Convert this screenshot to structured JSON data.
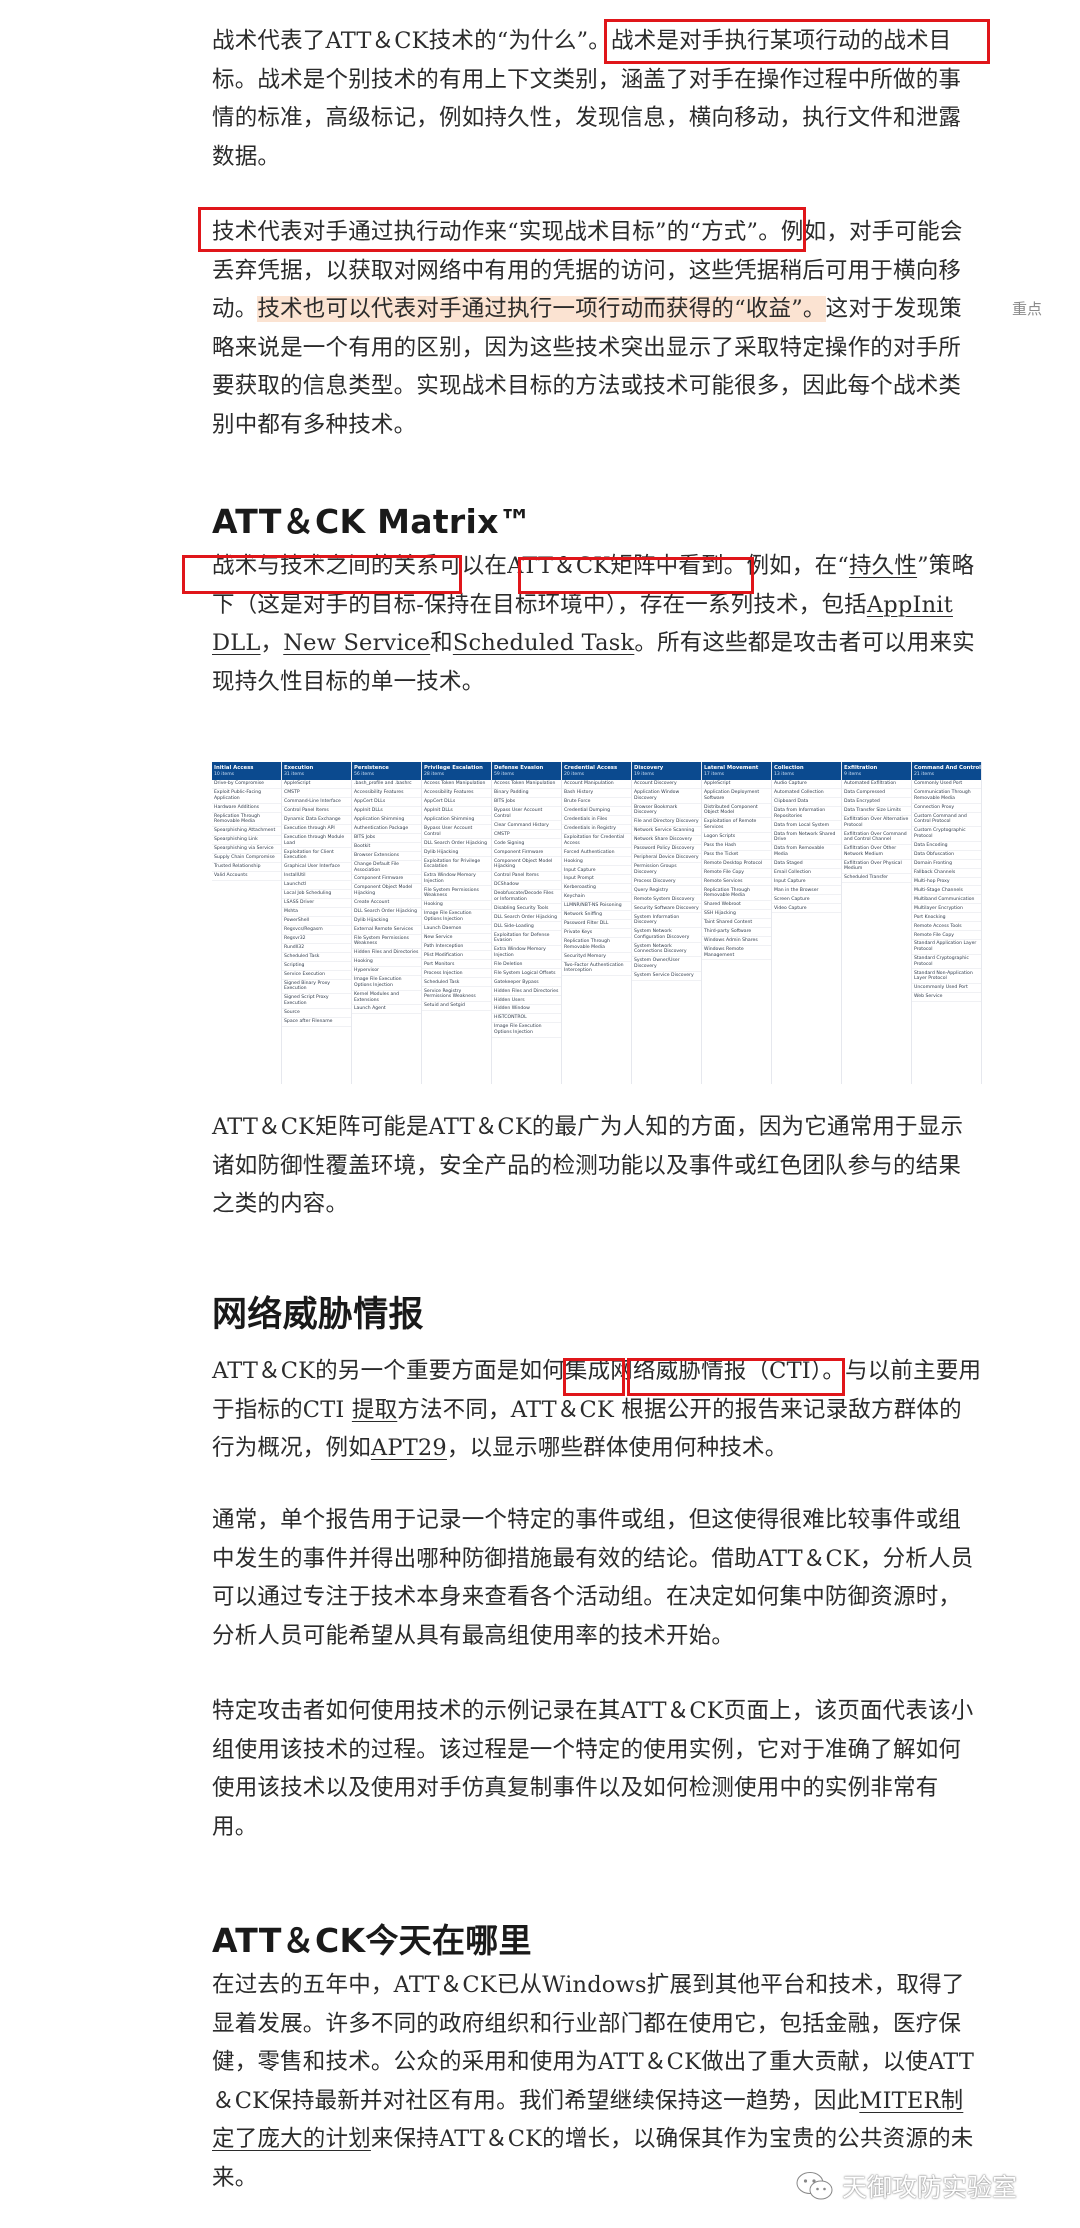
{
  "sections": {
    "intro": {
      "p1": [
        {
          "t": "战术代表了ATT＆CK技术的“为什么”。"
        },
        {
          "t": "战术是对手执行某项行动的战术目标。战术是个别技术的有用上下文类别，涵盖了对手在操作过程中所做的事情的标准，高级标记，例如持久性，发现信息，横向移动，执行文件和泄露数据。"
        }
      ],
      "p2": [
        {
          "t": "技术代表对手通过执行动作来“实现战术目标”的“方式”。"
        },
        {
          "t": "例如，对手可能会丢弃凭据，以获取对网络中有用的凭据的访问，这些凭据稍后可用于横向移动。"
        },
        {
          "t": "技术也可以代表对手通过执行一项行动而获得的“收益”。",
          "hl": true
        },
        {
          "t": "这对于发现策略来说是一个有用的区别，因为这些技术突出显示了采取特定操作的对手所要获取的信息类型。实现战术目标的方法或技术可能很多，因此每个战术类别中都有多种技术。"
        }
      ],
      "side_note": "重点"
    },
    "matrix": {
      "heading": "ATT＆CK Matrix™",
      "p1": [
        {
          "t": "战术与技术之间的关系可以在ATT＆CK矩阵中看到。例如，在“"
        },
        {
          "t": "持久性",
          "u": true
        },
        {
          "t": "”策略下（这是对手的目标-保持在目标环境中），存在一系列技术，包括"
        },
        {
          "t": "AppInit DLL",
          "u": true
        },
        {
          "t": "，"
        },
        {
          "t": "New Service",
          "u": true
        },
        {
          "t": "和"
        },
        {
          "t": "Scheduled Task",
          "u": true
        },
        {
          "t": "。所有这些都是攻击者可以用来实现持久性目标的单一技术。"
        }
      ],
      "p2": [
        {
          "t": "ATT＆CK矩阵可能是ATT＆CK的最广为人知的方面，因为它通常用于显示诸如防御性覆盖环境，安全产品的检测功能以及事件或红色团队参与的结果之类的内容。"
        }
      ]
    },
    "cti": {
      "heading": "网络威胁情报",
      "p1": [
        {
          "t": "ATT＆CK的另一个重要方面是如何集成网络威胁情报（CTI）。与以前主要用于指标的CTI "
        },
        {
          "t": "提取",
          "u": true
        },
        {
          "t": "方法不同，ATT＆CK 根据公开的报告来记录敌方群体的行为概况，例如"
        },
        {
          "t": "APT29",
          "u": true
        },
        {
          "t": "，以显示哪些群体使用何种技术。"
        }
      ],
      "p2": [
        {
          "t": "通常，单个报告用于记录一个特定的事件或组，但这使得很难比较事件或组中发生的事件并得出哪种防御措施最有效的结论。借助ATT＆CK，分析人员可以通过专注于技术本身来查看各个活动组。在决定如何集中防御资源时，分析人员可能希望从具有最高组使用率的技术开始。"
        }
      ],
      "p3": [
        {
          "t": "特定攻击者如何使用技术的示例记录在其ATT＆CK页面上，该页面代表该小组使用该技术的过程。该过程是一个特定的使用实例，它对于准确了解如何使用该技术以及使用对手仿真复制事件以及如何检测使用中的实例非常有用。"
        }
      ]
    },
    "today": {
      "heading": "ATT＆CK今天在哪里",
      "p1": [
        {
          "t": "在过去的五年中，ATT＆CK已从Windows扩展到其他平台和技术，取得了显着发展。许多不同的政府组织和行业部门都在使用它，包括金融，医疗保健，零售和技术。公众的采用和使用为ATT＆CK做出了重大贡献，以使ATT＆CK保持最新并对社区有用。我们希望继续保持这一趋势，因此"
        },
        {
          "t": "MITER制定了庞大的计划",
          "u": true
        },
        {
          "t": "来保持ATT＆CK的增长，以确保其作为宝贵的公共资源的未来。"
        }
      ]
    }
  },
  "matrix_table": {
    "columns": [
      {
        "name": "Initial Access",
        "count": "10 items",
        "cells": [
          "Drive-by Compromise",
          "Exploit Public-Facing Application",
          "Hardware Additions",
          "Replication Through Removable Media",
          "Spearphishing Attachment",
          "Spearphishing Link",
          "Spearphishing via Service",
          "Supply Chain Compromise",
          "Trusted Relationship",
          "Valid Accounts"
        ]
      },
      {
        "name": "Execution",
        "count": "31 items",
        "cells": [
          "AppleScript",
          "CMSTP",
          "Command-Line Interface",
          "Control Panel Items",
          "Dynamic Data Exchange",
          "Execution through API",
          "Execution through Module Load",
          "Exploitation for Client Execution",
          "Graphical User Interface",
          "InstallUtil",
          "Launchctl",
          "Local Job Scheduling",
          "LSASS Driver",
          "Mshta",
          "PowerShell",
          "Regsvcs/Regasm",
          "Regsvr32",
          "Rundll32",
          "Scheduled Task",
          "Scripting",
          "Service Execution",
          "Signed Binary Proxy Execution",
          "Signed Script Proxy Execution",
          "Source",
          "Space after Filename"
        ]
      },
      {
        "name": "Persistence",
        "count": "56 items",
        "cells": [
          ".bash_profile and .bashrc",
          "Accessibility Features",
          "AppCert DLLs",
          "AppInit DLLs",
          "Application Shimming",
          "Authentication Package",
          "BITS Jobs",
          "Bootkit",
          "Browser Extensions",
          "Change Default File Association",
          "Component Firmware",
          "Component Object Model Hijacking",
          "Create Account",
          "DLL Search Order Hijacking",
          "Dylib Hijacking",
          "External Remote Services",
          "File System Permissions Weakness",
          "Hidden Files and Directories",
          "Hooking",
          "Hypervisor",
          "Image File Execution Options Injection",
          "Kernel Modules and Extensions",
          "Launch Agent"
        ]
      },
      {
        "name": "Privilege Escalation",
        "count": "28 items",
        "cells": [
          "Access Token Manipulation",
          "Accessibility Features",
          "AppCert DLLs",
          "AppInit DLLs",
          "Application Shimming",
          "Bypass User Account Control",
          "DLL Search Order Hijacking",
          "Dylib Hijacking",
          "Exploitation for Privilege Escalation",
          "Extra Window Memory Injection",
          "File System Permissions Weakness",
          "Hooking",
          "Image File Execution Options Injection",
          "Launch Daemon",
          "New Service",
          "Path Interception",
          "Plist Modification",
          "Port Monitors",
          "Process Injection",
          "Scheduled Task",
          "Service Registry Permissions Weakness",
          "Setuid and Setgid"
        ]
      },
      {
        "name": "Defense Evasion",
        "count": "59 items",
        "cells": [
          "Access Token Manipulation",
          "Binary Padding",
          "BITS Jobs",
          "Bypass User Account Control",
          "Clear Command History",
          "CMSTP",
          "Code Signing",
          "Component Firmware",
          "Component Object Model Hijacking",
          "Control Panel Items",
          "DCShadow",
          "Deobfuscate/Decode Files or Information",
          "Disabling Security Tools",
          "DLL Search Order Hijacking",
          "DLL Side-Loading",
          "Exploitation for Defense Evasion",
          "Extra Window Memory Injection",
          "File Deletion",
          "File System Logical Offsets",
          "Gatekeeper Bypass",
          "Hidden Files and Directories",
          "Hidden Users",
          "Hidden Window",
          "HISTCONTROL",
          "Image File Execution Options Injection"
        ]
      },
      {
        "name": "Credential Access",
        "count": "20 items",
        "cells": [
          "Account Manipulation",
          "Bash History",
          "Brute Force",
          "Credential Dumping",
          "Credentials in Files",
          "Credentials in Registry",
          "Exploitation for Credential Access",
          "Forced Authentication",
          "Hooking",
          "Input Capture",
          "Input Prompt",
          "Kerberoasting",
          "Keychain",
          "LLMNR/NBT-NS Poisoning",
          "Network Sniffing",
          "Password Filter DLL",
          "Private Keys",
          "Replication Through Removable Media",
          "Securityd Memory",
          "Two-Factor Authentication Interception"
        ]
      },
      {
        "name": "Discovery",
        "count": "19 items",
        "cells": [
          "Account Discovery",
          "Application Window Discovery",
          "Browser Bookmark Discovery",
          "File and Directory Discovery",
          "Network Service Scanning",
          "Network Share Discovery",
          "Password Policy Discovery",
          "Peripheral Device Discovery",
          "Permission Groups Discovery",
          "Process Discovery",
          "Query Registry",
          "Remote System Discovery",
          "Security Software Discovery",
          "System Information Discovery",
          "System Network Configuration Discovery",
          "System Network Connections Discovery",
          "System Owner/User Discovery",
          "System Service Discovery"
        ]
      },
      {
        "name": "Lateral Movement",
        "count": "17 items",
        "cells": [
          "AppleScript",
          "Application Deployment Software",
          "Distributed Component Object Model",
          "Exploitation of Remote Services",
          "Logon Scripts",
          "Pass the Hash",
          "Pass the Ticket",
          "Remote Desktop Protocol",
          "Remote File Copy",
          "Remote Services",
          "Replication Through Removable Media",
          "Shared Webroot",
          "SSH Hijacking",
          "Taint Shared Content",
          "Third-party Software",
          "Windows Admin Shares",
          "Windows Remote Management"
        ]
      },
      {
        "name": "Collection",
        "count": "13 items",
        "cells": [
          "Audio Capture",
          "Automated Collection",
          "Clipboard Data",
          "Data from Information Repositories",
          "Data from Local System",
          "Data from Network Shared Drive",
          "Data from Removable Media",
          "Data Staged",
          "Email Collection",
          "Input Capture",
          "Man in the Browser",
          "Screen Capture",
          "Video Capture"
        ]
      },
      {
        "name": "Exfiltration",
        "count": "9 items",
        "cells": [
          "Automated Exfiltration",
          "Data Compressed",
          "Data Encrypted",
          "Data Transfer Size Limits",
          "Exfiltration Over Alternative Protocol",
          "Exfiltration Over Command and Control Channel",
          "Exfiltration Over Other Network Medium",
          "Exfiltration Over Physical Medium",
          "Scheduled Transfer"
        ]
      },
      {
        "name": "Command And Control",
        "count": "21 items",
        "cells": [
          "Commonly Used Port",
          "Communication Through Removable Media",
          "Connection Proxy",
          "Custom Command and Control Protocol",
          "Custom Cryptographic Protocol",
          "Data Encoding",
          "Data Obfuscation",
          "Domain Fronting",
          "Fallback Channels",
          "Multi-hop Proxy",
          "Multi-Stage Channels",
          "Multiband Communication",
          "Multilayer Encryption",
          "Port Knocking",
          "Remote Access Tools",
          "Remote File Copy",
          "Standard Application Layer Protocol",
          "Standard Cryptographic Protocol",
          "Standard Non-Application Layer Protocol",
          "Uncommonly Used Port",
          "Web Service"
        ]
      }
    ]
  },
  "watermark": {
    "text": "天御攻防实验室",
    "icon": "wechat-icon"
  },
  "colors": {
    "annotation_box": "#e0161a",
    "highlight": "#fbe3d2",
    "matrix_header": "#0b4a8f"
  }
}
